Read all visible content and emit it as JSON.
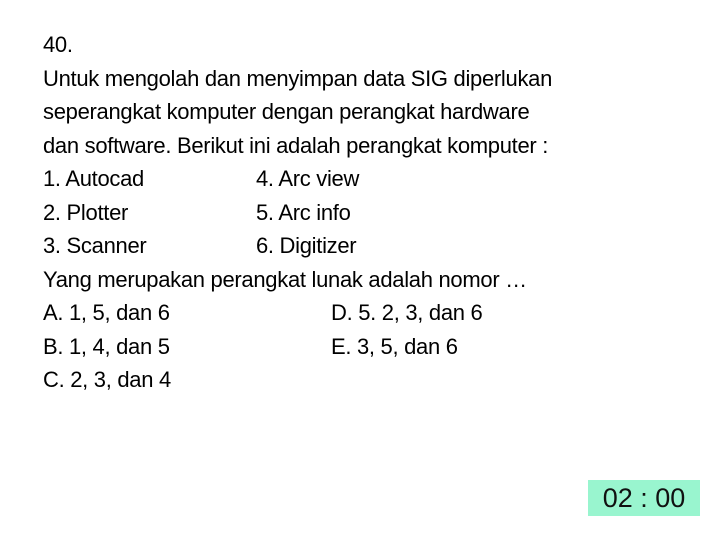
{
  "question": {
    "number": "40.",
    "stem_lines": [
      "Untuk mengolah dan menyimpan data SIG diperlukan",
      "seperangkat komputer dengan perangkat hardware",
      "dan software. Berikut ini adalah perangkat komputer :"
    ],
    "items": [
      {
        "left": "1. Autocad",
        "right": "4. Arc view"
      },
      {
        "left": "2. Plotter",
        "right": "5. Arc info"
      },
      {
        "left": "3. Scanner",
        "right": "6. Digitizer"
      }
    ],
    "prompt": "Yang merupakan perangkat lunak adalah nomor …",
    "options": [
      {
        "left": "A. 1, 5, dan 6",
        "right": "D. 5. 2, 3, dan 6"
      },
      {
        "left": "B. 1, 4, dan 5",
        "right": "E. 3, 5, dan 6"
      },
      {
        "left": "C. 2, 3, dan 4",
        "right": ""
      }
    ]
  },
  "timer": {
    "value": "02 : 00",
    "background_color": "#99f5cf"
  }
}
